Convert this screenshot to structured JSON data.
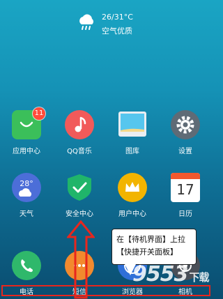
{
  "weather": {
    "icon": "cloud-rain-icon",
    "temperature": "26/31°C",
    "air_quality": "空气优质"
  },
  "apps_row1": [
    {
      "label": "应用中心",
      "icon": "shopping-bag-icon",
      "color": "#3bbf5a",
      "badge": "11"
    },
    {
      "label": "QQ音乐",
      "icon": "music-note-icon",
      "color": "#f15a5a"
    },
    {
      "label": "图库",
      "icon": "gallery-icon",
      "color": "#4fc3f7"
    },
    {
      "label": "设置",
      "icon": "gear-icon",
      "color": "#5f6b76"
    }
  ],
  "apps_row2": [
    {
      "label": "天气",
      "icon": "weather-icon",
      "color": "#4c6ed8",
      "value": "28°"
    },
    {
      "label": "安全中心",
      "icon": "shield-check-icon",
      "color": "#20b56a"
    },
    {
      "label": "用户中心",
      "icon": "crown-icon",
      "color": "#f2b400"
    },
    {
      "label": "日历",
      "icon": "calendar-icon",
      "color": "#f1582e",
      "value": "17"
    }
  ],
  "dock": [
    {
      "label": "电话",
      "icon": "phone-icon",
      "color": "#2fb86b"
    },
    {
      "label": "短信",
      "icon": "message-icon",
      "color": "#f28a2e"
    },
    {
      "label": "浏览器",
      "icon": "browser-icon",
      "color": "#2f6fd8"
    },
    {
      "label": "相机",
      "icon": "camera-icon",
      "color": "#4a4f57"
    }
  ],
  "callout": {
    "line1": "在【待机界面】上拉",
    "line2": "【快捷开关面板】"
  },
  "watermark": {
    "text": "9553",
    "suffix": "下载"
  }
}
